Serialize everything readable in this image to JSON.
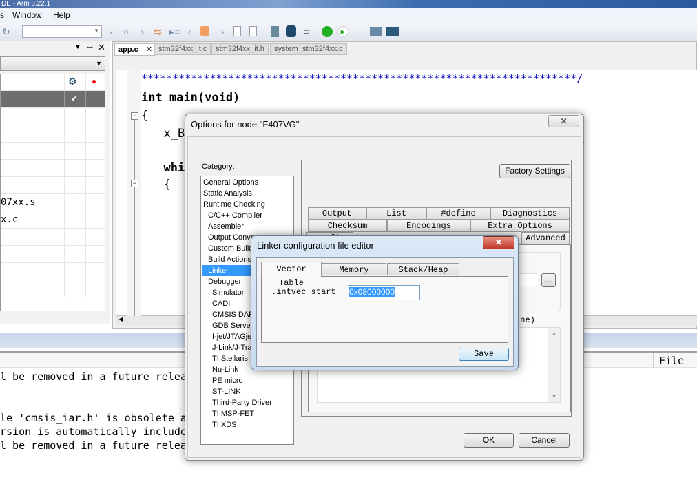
{
  "window": {
    "title": "DE - Arm 8.22.1"
  },
  "menu": [
    "s",
    "Window",
    "Help"
  ],
  "toolbar": {
    "combo_value": "",
    "icons": [
      "refresh-icon",
      "back-icon",
      "find-icon",
      "forward-icon",
      "swap-icon",
      "goto-icon",
      "prev-bookmark-icon",
      "bookmark-icon",
      "next-bookmark-icon",
      "prev-page-icon",
      "next-page-icon",
      "download-icon",
      "download-debug-icon",
      "breakpoint-list-icon",
      "debug-run-icon",
      "run-icon",
      "workspace-icon",
      "add-workspace-icon"
    ]
  },
  "left_panel": {
    "dropdown_value": "",
    "rows": [
      "",
      "",
      "",
      "",
      "",
      "",
      "07xx.s",
      "x.c",
      "",
      "",
      "",
      ""
    ]
  },
  "editor": {
    "tabs": [
      {
        "label": "app.c",
        "active": true
      },
      {
        "label": "stm32f4xx_it.c"
      },
      {
        "label": "stm32f4xx_it.h"
      },
      {
        "label": "system_stm32f4xx.c"
      }
    ],
    "lines": [
      "**********************************************************************/",
      "int main(void)",
      "{",
      "  x_Bs",
      "",
      "  whi",
      "  {"
    ]
  },
  "output": {
    "header": "File",
    "lines": [
      "l be removed in a future relea",
      "",
      "",
      "le 'cmsis_iar.h' is obsolete a",
      "rsion is automatically include",
      "l be removed in a future relea"
    ]
  },
  "options_dialog": {
    "title": "Options for node \"F407VG\"",
    "category_label": "Category:",
    "categories": [
      {
        "label": "General Options",
        "sub": false
      },
      {
        "label": "Static Analysis",
        "sub": false
      },
      {
        "label": "Runtime Checking",
        "sub": false
      },
      {
        "label": "C/C++ Compiler",
        "sub": true
      },
      {
        "label": "Assembler",
        "sub": true
      },
      {
        "label": "Output Converter",
        "sub": true
      },
      {
        "label": "Custom Build",
        "sub": true
      },
      {
        "label": "Build Actions",
        "sub": true
      },
      {
        "label": "Linker",
        "sub": true,
        "selected": true
      },
      {
        "label": "Debugger",
        "sub": true
      },
      {
        "label": "Simulator",
        "sub": 2
      },
      {
        "label": "CADI",
        "sub": 2
      },
      {
        "label": "CMSIS DAP",
        "sub": 2
      },
      {
        "label": "GDB Server",
        "sub": 2
      },
      {
        "label": "I-jet/JTAGjet",
        "sub": 2
      },
      {
        "label": "J-Link/J-Trace",
        "sub": 2
      },
      {
        "label": "TI Stellaris",
        "sub": 2
      },
      {
        "label": "Nu-Link",
        "sub": 2
      },
      {
        "label": "PE micro",
        "sub": 2
      },
      {
        "label": "ST-LINK",
        "sub": 2
      },
      {
        "label": "Third-Party Driver",
        "sub": 2
      },
      {
        "label": "TI MSP-FET",
        "sub": 2
      },
      {
        "label": "TI XDS",
        "sub": 2
      }
    ],
    "factory_settings": "Factory Settings",
    "tabs_row1": [
      "Output",
      "List",
      "#define",
      "Diagnostics"
    ],
    "tabs_row2": [
      "Checksum",
      "Encodings",
      "Extra Options"
    ],
    "tabs_row3": [
      "Config",
      "",
      "",
      "",
      "Advanced"
    ],
    "partial_label": "ine)",
    "browse": "...",
    "ok": "OK",
    "cancel": "Cancel"
  },
  "linker_dialog": {
    "title": "Linker configuration file editor",
    "tabs": [
      "Vector Table",
      "Memory Regions",
      "Stack/Heap Sizes"
    ],
    "active_tab": "Vector Table",
    "field_label": ".intvec start",
    "field_value": "0x08000000",
    "save": "Save"
  },
  "colors": {
    "selection": "#3399ff",
    "close_red": "#c8483c",
    "code_keyword": "#000000",
    "comment": "#0000c0"
  }
}
